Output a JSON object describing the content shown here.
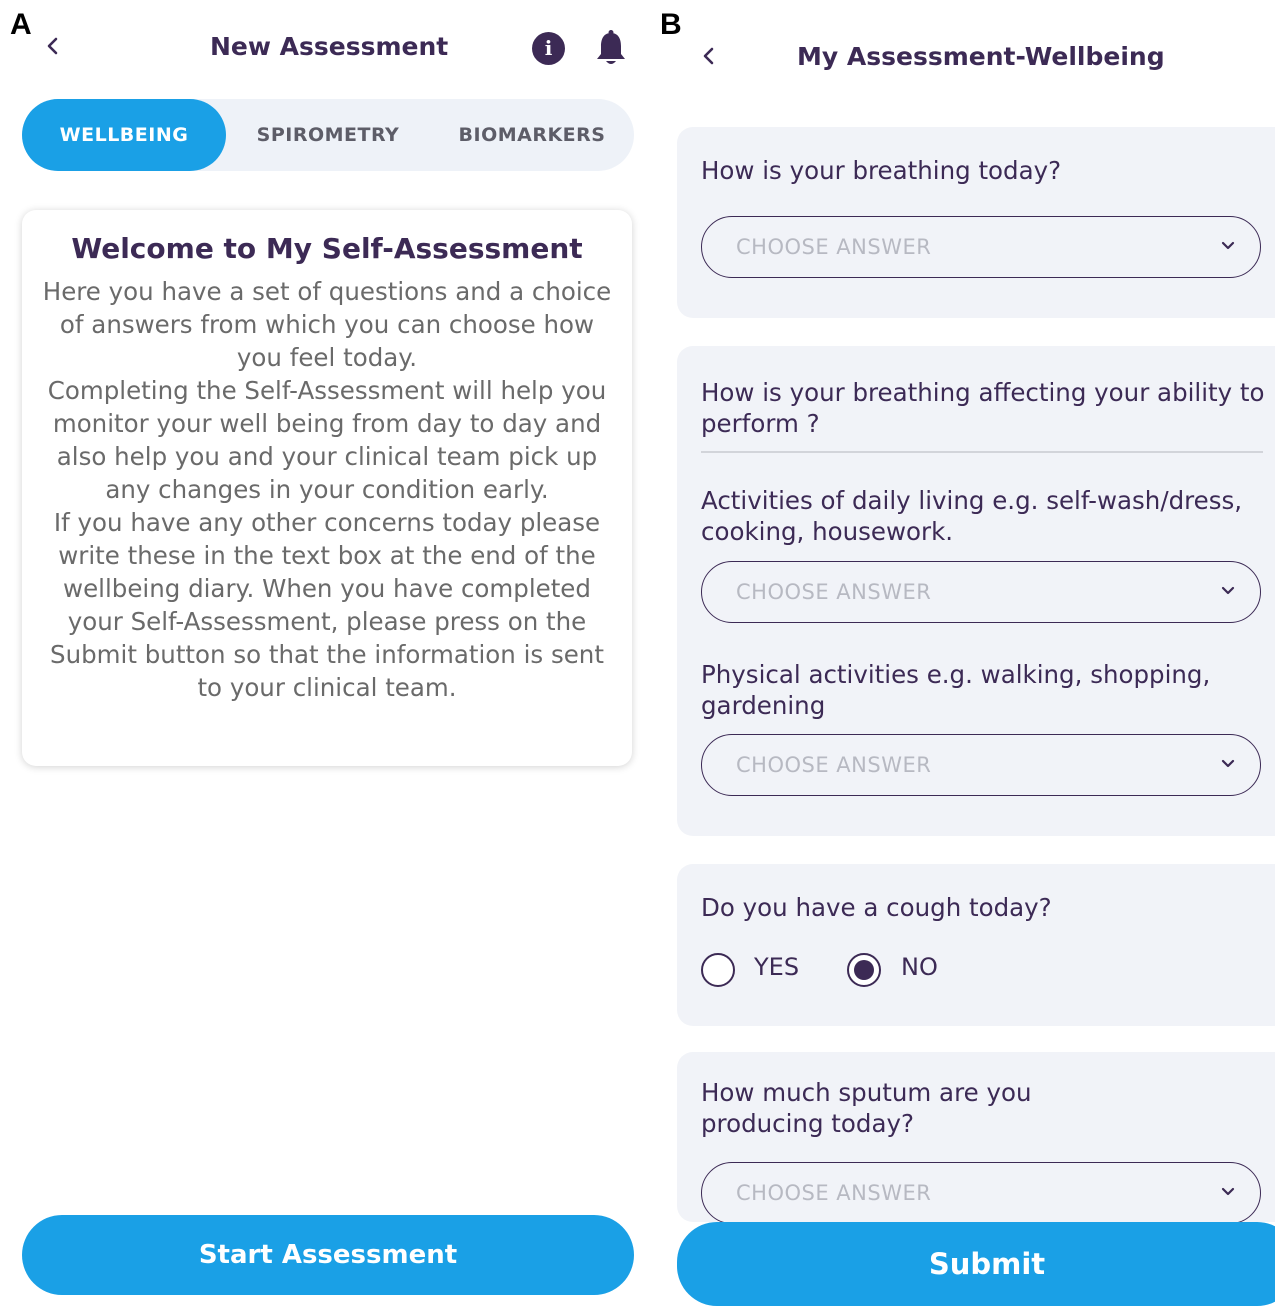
{
  "panels": {
    "a": "A",
    "b": "B"
  },
  "screen_a": {
    "title": "New Assessment",
    "tabs": [
      "WELLBEING",
      "SPIROMETRY",
      "BIOMARKERS"
    ],
    "active_tab": "WELLBEING",
    "card_title": "Welcome to My Self-Assessment",
    "card_body": "Here you have a set of questions and a choice of answers from which you can choose how you feel today.\nCompleting the Self-Assessment will help you monitor your well being from day to day and also help you and your clinical team pick up any changes in your condition early.\nIf you have any other concerns today please write these in the text box at the end of the wellbeing diary. When you have completed your Self-Assessment, please press on the Submit button so that the information is sent to your clinical team.",
    "start_button": "Start Assessment",
    "icons": [
      "back-icon",
      "info-icon",
      "bell-icon"
    ]
  },
  "screen_b": {
    "title": "My Assessment-Wellbeing",
    "placeholder": "CHOOSE ANSWER",
    "q1": "How is your breathing today?",
    "q2_header": "How is your breathing affecting your ability to perform ?",
    "q2a": "Activities of daily living e.g. self-wash/dress, cooking, housework.",
    "q2b": "Physical activities e.g. walking, shopping, gardening",
    "q3": "Do you have a cough today?",
    "q3_options": [
      "YES",
      "NO"
    ],
    "q3_selected": "NO",
    "q4": "How much sputum are you producing today?",
    "submit_button": "Submit"
  },
  "colors": {
    "primary": "#1aa0e6",
    "text_dark": "#3c2a55",
    "card_bg": "#f1f3f8",
    "tab_bg": "#eef2f8"
  }
}
